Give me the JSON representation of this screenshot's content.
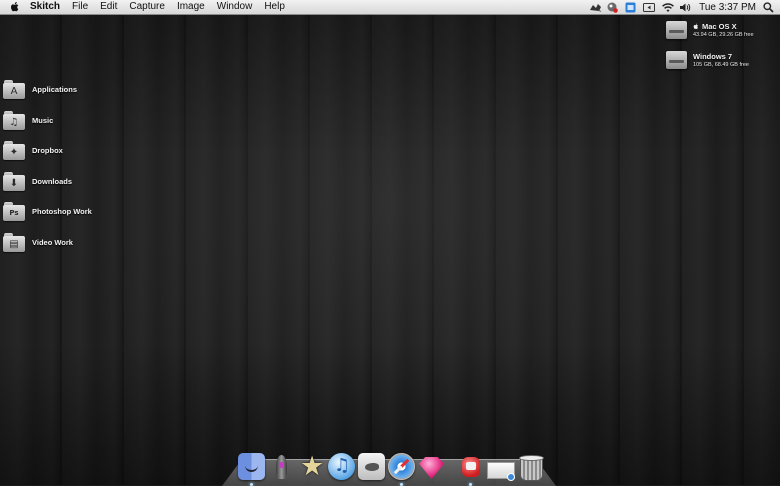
{
  "menubar": {
    "app_name": "Skitch",
    "menus": [
      "File",
      "Edit",
      "Capture",
      "Image",
      "Window",
      "Help"
    ],
    "status_icons": [
      "skitch-icon",
      "growl-icon",
      "dropbox-icon",
      "display-icon",
      "wifi-icon",
      "volume-icon"
    ],
    "clock": "Tue 3:37 PM",
    "spotlight_icon": "search-icon"
  },
  "desktop": {
    "items": [
      {
        "label": "Applications",
        "icon": "applications-folder-icon",
        "glyph": "A"
      },
      {
        "label": "Music",
        "icon": "music-folder-icon",
        "glyph": "♫"
      },
      {
        "label": "Dropbox",
        "icon": "dropbox-folder-icon",
        "glyph": "✦"
      },
      {
        "label": "Downloads",
        "icon": "downloads-folder-icon",
        "glyph": "⬇"
      },
      {
        "label": "Photoshop Work",
        "icon": "photoshop-folder-icon",
        "glyph": "Ps"
      },
      {
        "label": "Video Work",
        "icon": "video-folder-icon",
        "glyph": "▤"
      }
    ],
    "disks": [
      {
        "name": "Mac OS X",
        "info": "43.94 GB, 29.26 GB free",
        "icon": "hard-drive-icon"
      },
      {
        "name": "Windows 7",
        "info": "105 GB, 68.49 GB free",
        "icon": "hard-drive-icon"
      }
    ]
  },
  "dock": {
    "apps": [
      "finder-icon",
      "rocket-icon",
      "imovie-icon",
      "itunes-icon",
      "twitter-icon",
      "safari-icon",
      "gem-icon",
      "app-icon",
      "documents-icon",
      "trash-icon"
    ]
  }
}
